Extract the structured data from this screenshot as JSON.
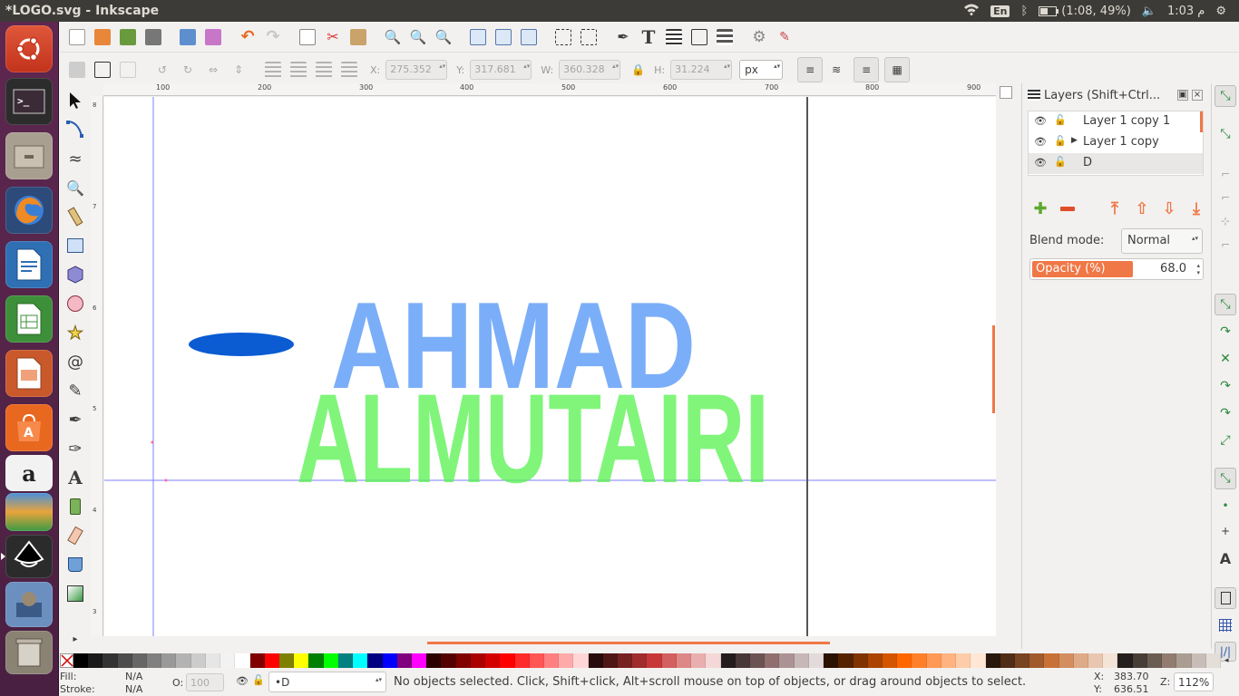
{
  "window": {
    "title": "*LOGO.svg - Inkscape"
  },
  "tray": {
    "keyboard": "En",
    "battery": "(1:08, 49%)",
    "clock": "1:03 م"
  },
  "launcher": {
    "items": [
      "ubuntu-dash",
      "terminal",
      "files",
      "firefox",
      "writer",
      "calc",
      "impress",
      "software-center",
      "amazon",
      "stack",
      "inkscape",
      "gimp",
      "trash"
    ]
  },
  "toolbar": {
    "x_label": "X:",
    "x_value": "275.352",
    "y_label": "Y:",
    "y_value": "317.681",
    "w_label": "W:",
    "w_value": "360.328",
    "h_label": "H:",
    "h_value": "31.224",
    "unit": "px"
  },
  "rulers": {
    "h_labels": [
      "100",
      "200",
      "300",
      "400",
      "500",
      "600",
      "700",
      "800",
      "900"
    ],
    "v_labels": [
      "8",
      "7",
      "6",
      "5",
      "4",
      "3"
    ]
  },
  "canvas": {
    "line1_text": "AHMAD",
    "line2_text": "ALMUTAIRI",
    "blue_color": "#4f93f5",
    "green_color": "#56f24e",
    "ellipse_color": "#0b5bd3"
  },
  "layers_panel": {
    "title": "Layers (Shift+Ctrl...",
    "layers": [
      {
        "name": "Layer 1 copy 1",
        "expander": false,
        "selected": false
      },
      {
        "name": "Layer 1 copy",
        "expander": true,
        "selected": false
      },
      {
        "name": "D",
        "expander": false,
        "selected": true
      }
    ],
    "blend_label": "Blend mode:",
    "blend_value": "Normal",
    "opacity_label": "Opacity (%)",
    "opacity_value": "68.0"
  },
  "status": {
    "fill_label": "Fill:",
    "fill_value": "N/A",
    "stroke_label": "Stroke:",
    "stroke_value": "N/A",
    "o_label": "O:",
    "o_value": "100",
    "layer_value": "•D",
    "message": "No objects selected. Click, Shift+click, Alt+scroll mouse on top of objects, or drag around objects to select.",
    "x_label": "X:",
    "x_value": "383.70",
    "y_label": "Y:",
    "y_value": "636.51",
    "z_label": "Z:",
    "z_value": "112%"
  },
  "palette": [
    "#000000",
    "#1a1a1a",
    "#333333",
    "#4d4d4d",
    "#666666",
    "#808080",
    "#999999",
    "#b3b3b3",
    "#cccccc",
    "#e6e6e6",
    "#f2f2f2",
    "#ffffff",
    "#800000",
    "#ff0000",
    "#808000",
    "#ffff00",
    "#008000",
    "#00ff00",
    "#008080",
    "#00ffff",
    "#000080",
    "#0000ff",
    "#800080",
    "#ff00ff",
    "#2b0000",
    "#550000",
    "#800000",
    "#aa0000",
    "#d40000",
    "#ff0000",
    "#ff2a2a",
    "#ff5555",
    "#ff8080",
    "#ffaaaa",
    "#ffd5d5",
    "#280b0b",
    "#501616",
    "#782121",
    "#a02c2c",
    "#c83737",
    "#d35f5f",
    "#de8787",
    "#e9afaf",
    "#f4d7d7",
    "#241c1c",
    "#483737",
    "#6c5353",
    "#916f6f",
    "#ac9393",
    "#c8b7b7",
    "#e3dbdb",
    "#2b1100",
    "#552200",
    "#803300",
    "#aa4400",
    "#d45500",
    "#ff6600",
    "#ff7f2a",
    "#ff9955",
    "#ffb380",
    "#ffccaa",
    "#ffe6d5",
    "#28170b",
    "#502d16",
    "#784421",
    "#a05a2c",
    "#c87137",
    "#d38d5f",
    "#deaa87",
    "#e9c6af",
    "#f4e3d7",
    "#241f1c",
    "#483e37",
    "#6c5d53",
    "#917c6f",
    "#ac9d93",
    "#c8beb7",
    "#e3ded7"
  ]
}
